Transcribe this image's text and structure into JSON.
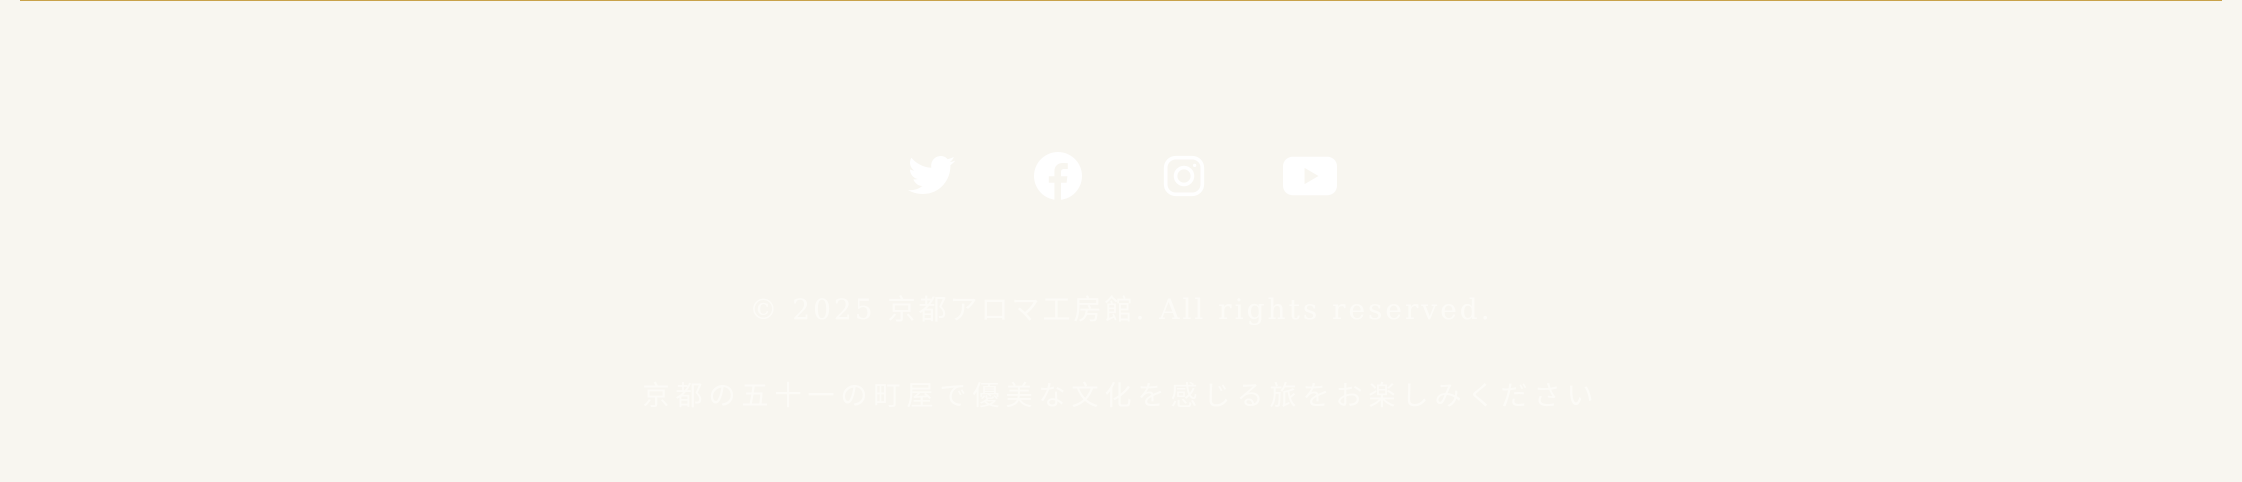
{
  "footer": {
    "social_links": [
      {
        "name": "Twitter",
        "icon": "twitter-icon"
      },
      {
        "name": "Facebook",
        "icon": "facebook-icon"
      },
      {
        "name": "Instagram",
        "icon": "instagram-icon"
      },
      {
        "name": "YouTube",
        "icon": "youtube-icon"
      }
    ],
    "copyright": "© 2025 京都アロマ工房館. All rights reserved.",
    "tagline": "京都の五十一の町屋で優美な文化を感じる旅をお楽しみください"
  },
  "colors": {
    "background": "#f8f6f0",
    "accent_rule": "#c9a24a",
    "foreground": "#fdfcf8"
  }
}
